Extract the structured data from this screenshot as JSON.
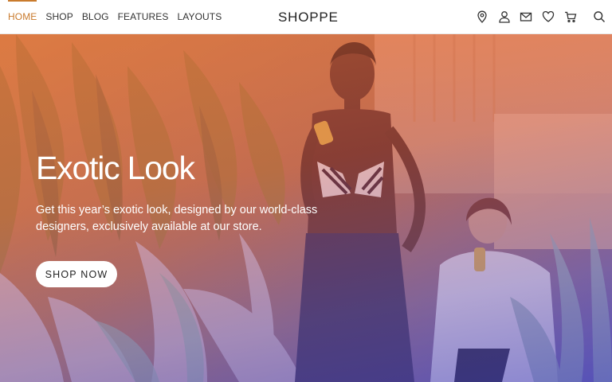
{
  "nav": {
    "items": [
      {
        "label": "HOME",
        "active": true
      },
      {
        "label": "SHOP",
        "active": false
      },
      {
        "label": "BLOG",
        "active": false
      },
      {
        "label": "FEATURES",
        "active": false
      },
      {
        "label": "LAYOUTS",
        "active": false
      }
    ]
  },
  "brand": "SHOPPE",
  "header_icons": [
    "location-icon",
    "user-icon",
    "mail-icon",
    "heart-icon",
    "cart-icon",
    "search-icon"
  ],
  "colors": {
    "accent": "#c97b2d",
    "overlay_top": "#e86e3c",
    "overlay_bottom": "#4646be"
  },
  "hero": {
    "title": "Exotic Look",
    "subtitle": "Get this year’s exotic look, designed by our world-class designers, exclusively available at our store.",
    "cta": "SHOP NOW"
  }
}
